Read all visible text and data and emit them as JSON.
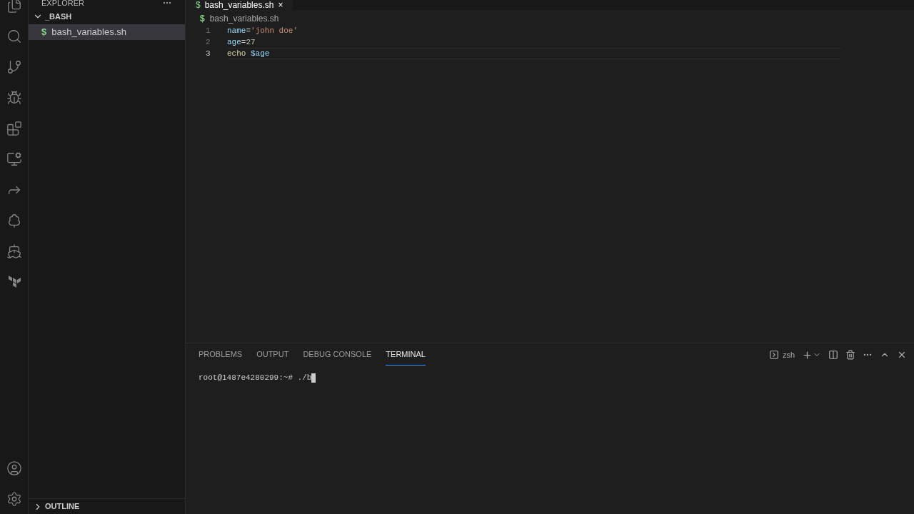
{
  "sidebar": {
    "title": "EXPLORER",
    "folder": {
      "name": "_BASH",
      "expanded": true,
      "files": [
        {
          "icon": "$",
          "name": "bash_variables.sh",
          "selected": true
        }
      ]
    },
    "outline": {
      "name": "OUTLINE",
      "expanded": false
    }
  },
  "editor": {
    "tabs": [
      {
        "icon": "$",
        "name": "bash_variables.sh",
        "close": "×",
        "selected": true
      }
    ],
    "breadcrumb": {
      "icon": "$",
      "name": "bash_variables.sh"
    },
    "lines": [
      {
        "number": "1",
        "current": false,
        "tokens": [
          {
            "kind": "variable",
            "text": "name"
          },
          {
            "kind": "operator",
            "text": "="
          },
          {
            "kind": "string",
            "text": "'john doe'"
          }
        ]
      },
      {
        "number": "2",
        "current": false,
        "tokens": [
          {
            "kind": "variable",
            "text": "age"
          },
          {
            "kind": "operator",
            "text": "="
          },
          {
            "kind": "number",
            "text": "27"
          }
        ]
      },
      {
        "number": "3",
        "current": true,
        "tokens": [
          {
            "kind": "command",
            "text": "echo"
          },
          {
            "kind": "space"
          },
          {
            "kind": "variable",
            "text": "$age"
          }
        ]
      }
    ]
  },
  "panel": {
    "tabs": [
      {
        "label": "PROBLEMS",
        "selected": false
      },
      {
        "label": "OUTPUT",
        "selected": false
      },
      {
        "label": "DEBUG CONSOLE",
        "selected": false
      },
      {
        "label": "TERMINAL",
        "selected": true
      }
    ],
    "shell": "zsh",
    "terminal_line": "root@1487e4280299:~# ./b"
  }
}
